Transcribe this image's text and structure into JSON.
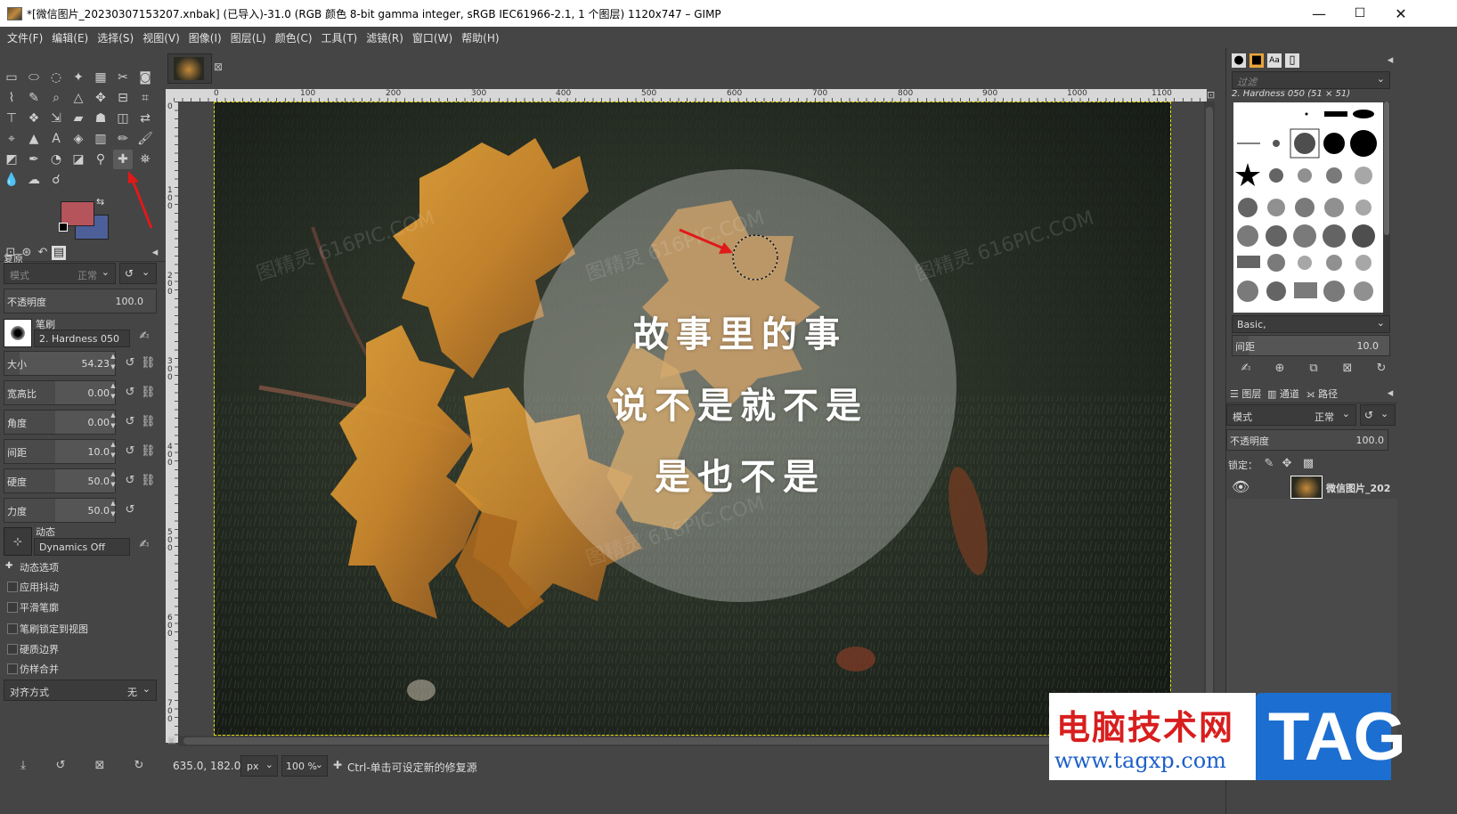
{
  "window": {
    "title": "*[微信图片_20230307153207.xnbak] (已导入)-31.0 (RGB 颜色 8-bit gamma integer, sRGB IEC61966-2.1, 1 个图层) 1120x747 – GIMP",
    "minimize": "—",
    "maximize": "☐",
    "close": "✕"
  },
  "menu": [
    "文件(F)",
    "编辑(E)",
    "选择(S)",
    "视图(V)",
    "图像(I)",
    "图层(L)",
    "颜色(C)",
    "工具(T)",
    "滤镜(R)",
    "窗口(W)",
    "帮助(H)"
  ],
  "tool_options": {
    "title": "复原",
    "mode_label": "模式",
    "mode_value": "正常",
    "opacity_label": "不透明度",
    "opacity_value": "100.0",
    "brush_label": "笔刷",
    "brush_value": "2. Hardness 050",
    "sliders": [
      {
        "label": "大小",
        "value": "54.23"
      },
      {
        "label": "宽高比",
        "value": "0.00"
      },
      {
        "label": "角度",
        "value": "0.00"
      },
      {
        "label": "间距",
        "value": "10.0"
      },
      {
        "label": "硬度",
        "value": "50.0"
      },
      {
        "label": "力度",
        "value": "50.0"
      }
    ],
    "dynamics_label": "动态",
    "dynamics_value": "Dynamics Off",
    "checks": [
      "动态选项",
      "应用抖动",
      "平滑笔廓",
      "笔刷锁定到视图",
      "硬质边界",
      "仿样合并"
    ],
    "align_label": "对齐方式",
    "align_value": "无"
  },
  "ruler": {
    "h_ticks": [
      "0",
      "100",
      "200",
      "300",
      "400",
      "500",
      "600",
      "700",
      "800",
      "900",
      "1000",
      "1100"
    ],
    "v_ticks": [
      "0",
      "1\n0\n0",
      "2\n0\n0",
      "3\n0\n0",
      "4\n0\n0",
      "5\n0\n0",
      "6\n0\n0",
      "7\n0\n0"
    ]
  },
  "image_text": {
    "line1": "故事里的事",
    "line2": "说不是就不是",
    "line3": "是也不是",
    "watermark": "图精灵 616PIC.COM"
  },
  "status": {
    "coords": "635.0, 182.0",
    "unit": "px",
    "zoom": "100 %",
    "message": "Ctrl-单击可设定新的修复源"
  },
  "brushes": {
    "filter_placeholder": "过滤",
    "selected": "2. Hardness 050 (51 × 51)",
    "tag": "Basic,",
    "spacing_label": "间距",
    "spacing_value": "10.0"
  },
  "layers": {
    "tabs": [
      "图层",
      "通道",
      "路径"
    ],
    "mode_label": "模式",
    "mode_value": "正常",
    "opacity_label": "不透明度",
    "opacity_value": "100.0",
    "lock_label": "锁定：",
    "layer_name": "微信图片_202"
  },
  "watermark_badge": {
    "site_name": "电脑技术网",
    "url": "www.tagxp.com",
    "tag": "TAG"
  },
  "colors": {
    "foreground": "#b5545b",
    "background": "#4d5f98"
  }
}
